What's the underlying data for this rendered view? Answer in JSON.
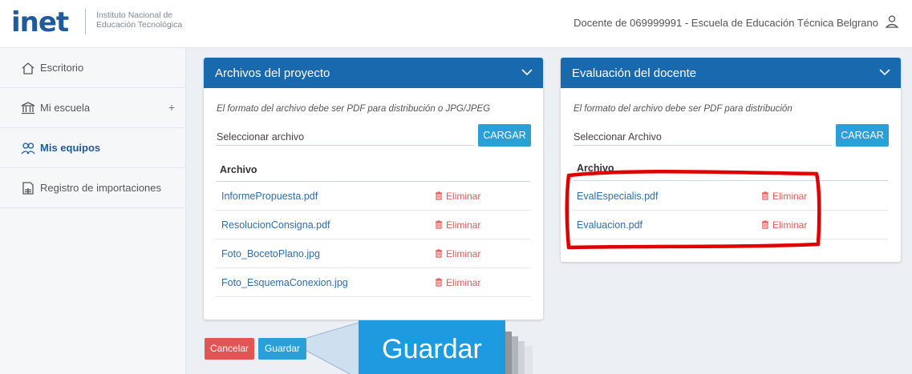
{
  "header": {
    "logo_text": "inet",
    "logo_sub_line1": "Instituto Nacional de",
    "logo_sub_line2": "Educación Tecnológica",
    "user_text": "Docente de 069999991 - Escuela de Educación Técnica Belgrano",
    "user_icon": "user-icon"
  },
  "sidebar": {
    "items": [
      {
        "label": "Escritorio",
        "icon": "home-icon"
      },
      {
        "label": "Mi escuela",
        "icon": "school-icon",
        "plus": "+"
      },
      {
        "label": "Mis equipos",
        "icon": "team-icon",
        "active": true
      },
      {
        "label": "Registro de importaciones",
        "icon": "document-icon"
      }
    ]
  },
  "cards": {
    "project": {
      "title": "Archivos del proyecto",
      "hint": "El formato del archivo debe ser PDF para distribución o JPG/JPEG",
      "file_label": "Seleccionar archivo",
      "upload_label": "CARGAR",
      "col_header": "Archivo",
      "files": [
        {
          "name": "InformePropuesta.pdf",
          "action": "Eliminar"
        },
        {
          "name": "ResolucionConsigna.pdf",
          "action": "Eliminar"
        },
        {
          "name": "Foto_BocetoPlano.jpg",
          "action": "Eliminar"
        },
        {
          "name": "Foto_EsquemaConexion.jpg",
          "action": "Eliminar"
        }
      ]
    },
    "teacher": {
      "title": "Evaluación del docente",
      "hint": "El formato del archivo debe ser PDF para distribución",
      "file_label": "Seleccionar Archivo",
      "upload_label": "CARGAR",
      "col_header": "Archivo",
      "files": [
        {
          "name": "EvalEspecialis.pdf",
          "action": "Eliminar"
        },
        {
          "name": "Evaluacion.pdf",
          "action": "Eliminar"
        }
      ]
    }
  },
  "actions": {
    "cancel_label": "Cancelar",
    "save_label": "Guardar"
  },
  "annotation": {
    "zoom_label": "Guardar",
    "highlight_color": "#e00000"
  },
  "colors": {
    "primary": "#1869ad",
    "accent": "#2a9fd8",
    "danger": "#e25b5b"
  }
}
